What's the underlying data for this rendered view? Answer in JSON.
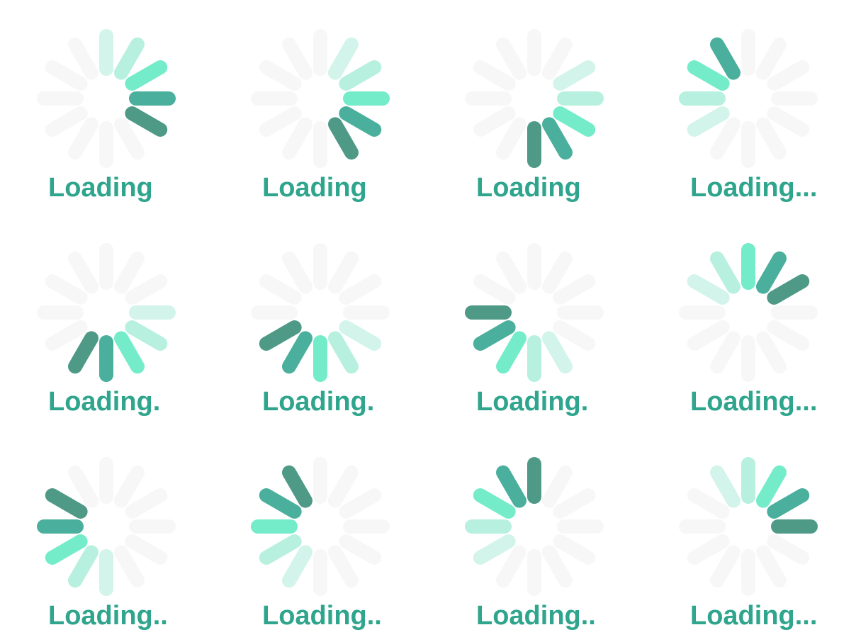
{
  "colors": {
    "text": "#2fa58d",
    "inactive_bar": "#f7f7f7",
    "shades": [
      "#4e9a87",
      "#4aaf9c",
      "#74ecc9",
      "#b8f0df",
      "#d3f4ea"
    ]
  },
  "spinners": [
    {
      "label": "Loading",
      "bars": [
        4,
        3,
        2,
        1,
        0,
        null,
        null,
        null,
        null,
        null,
        null,
        null
      ]
    },
    {
      "label": "Loading",
      "bars": [
        null,
        4,
        3,
        2,
        1,
        0,
        null,
        null,
        null,
        null,
        null,
        null
      ]
    },
    {
      "label": "Loading",
      "bars": [
        null,
        null,
        4,
        3,
        2,
        1,
        0,
        null,
        null,
        null,
        null,
        null
      ]
    },
    {
      "label": "Loading...",
      "bars": [
        null,
        null,
        null,
        null,
        null,
        null,
        null,
        null,
        4,
        3,
        2,
        1
      ]
    },
    {
      "label": "Loading.",
      "bars": [
        null,
        null,
        null,
        4,
        3,
        2,
        1,
        0,
        null,
        null,
        null,
        null
      ]
    },
    {
      "label": "Loading.",
      "bars": [
        null,
        null,
        null,
        null,
        4,
        3,
        2,
        1,
        0,
        null,
        null,
        null
      ]
    },
    {
      "label": "Loading.",
      "bars": [
        null,
        null,
        null,
        null,
        null,
        4,
        3,
        2,
        1,
        0,
        null,
        null
      ]
    },
    {
      "label": "Loading...",
      "bars": [
        2,
        1,
        0,
        null,
        null,
        null,
        null,
        null,
        null,
        null,
        4,
        3
      ]
    },
    {
      "label": "Loading..",
      "bars": [
        null,
        null,
        null,
        null,
        null,
        null,
        4,
        3,
        2,
        1,
        0,
        null
      ]
    },
    {
      "label": "Loading..",
      "bars": [
        null,
        null,
        null,
        null,
        null,
        null,
        null,
        4,
        3,
        2,
        1,
        0
      ]
    },
    {
      "label": "Loading..",
      "bars": [
        0,
        null,
        null,
        null,
        null,
        null,
        null,
        null,
        4,
        3,
        2,
        1
      ]
    },
    {
      "label": "Loading...",
      "bars": [
        3,
        2,
        1,
        0,
        null,
        null,
        null,
        null,
        null,
        null,
        null,
        4
      ]
    }
  ]
}
